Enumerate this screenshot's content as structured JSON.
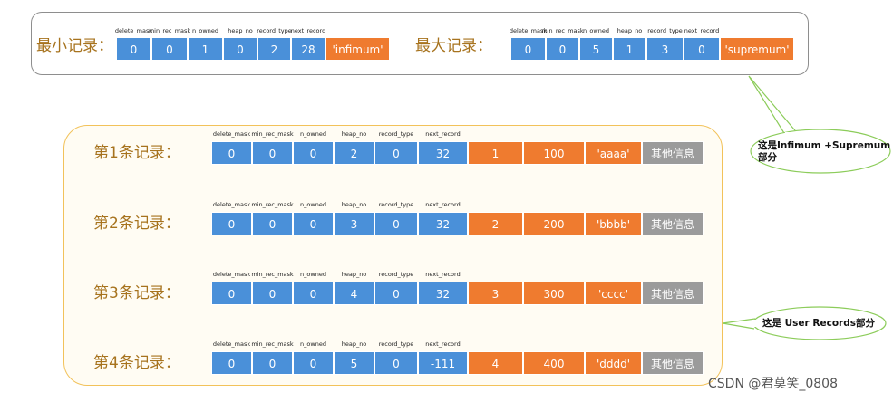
{
  "headers": [
    "delete_mask",
    "min_rec_mask",
    "n_owned",
    "heap_no",
    "record_type",
    "next_record"
  ],
  "min_record": {
    "label": "最小记录：",
    "header_values": [
      "0",
      "0",
      "1",
      "0",
      "2",
      "28"
    ],
    "data_value": "'infimum'"
  },
  "max_record": {
    "label": "最大记录：",
    "header_values": [
      "0",
      "0",
      "5",
      "1",
      "3",
      "0"
    ],
    "data_value": "'supremum'"
  },
  "user_records": [
    {
      "label": "第1条记录：",
      "header_values": [
        "0",
        "0",
        "0",
        "2",
        "0",
        "32"
      ],
      "data_values": [
        "1",
        "100",
        "'aaaa'"
      ],
      "other": "其他信息"
    },
    {
      "label": "第2条记录：",
      "header_values": [
        "0",
        "0",
        "0",
        "3",
        "0",
        "32"
      ],
      "data_values": [
        "2",
        "200",
        "'bbbb'"
      ],
      "other": "其他信息"
    },
    {
      "label": "第3条记录：",
      "header_values": [
        "0",
        "0",
        "0",
        "4",
        "0",
        "32"
      ],
      "data_values": [
        "3",
        "300",
        "'cccc'"
      ],
      "other": "其他信息"
    },
    {
      "label": "第4条记录：",
      "header_values": [
        "0",
        "0",
        "0",
        "5",
        "0",
        "-111"
      ],
      "data_values": [
        "4",
        "400",
        "'dddd'"
      ],
      "other": "其他信息"
    }
  ],
  "callouts": {
    "infimum_supremum_line1": "这是Infimum +Supremum",
    "infimum_supremum_line2": "部分",
    "user_records": "这是 User Records部分"
  },
  "watermark": "CSDN @君莫笑_0808",
  "colors": {
    "header_cell": "#4a90d9",
    "data_cell": "#ef7b2f",
    "other_cell": "#9b9b9b",
    "label_text": "#a7731e",
    "user_panel_border": "#f2c25a",
    "callout_border": "#8ccc5a"
  }
}
